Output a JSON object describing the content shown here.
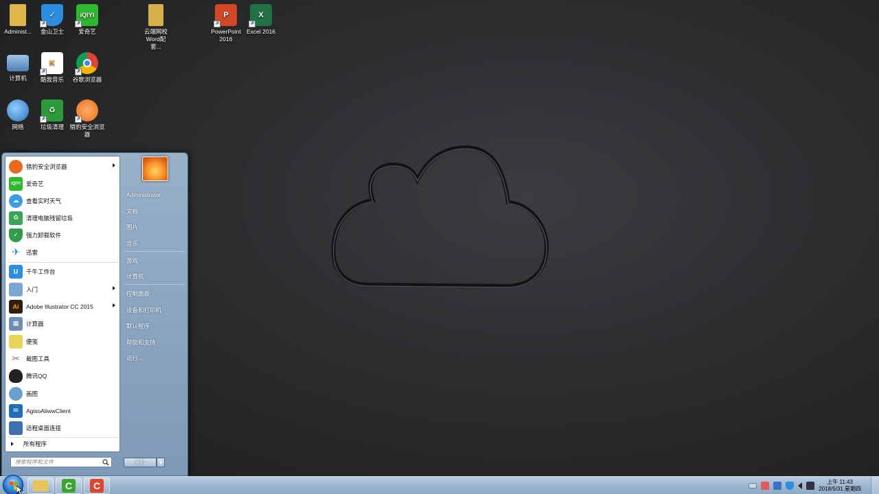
{
  "desktop": {
    "icons": [
      {
        "label": "Administ...",
        "icon": "folder-user-icon",
        "color": "#e9c25a"
      },
      {
        "label": "金山卫士",
        "icon": "shield-icon",
        "color": "#2d8ee0"
      },
      {
        "label": "爱奇艺",
        "icon": "iqiyi-icon",
        "color": "#2eb82e"
      },
      {
        "label": "云端网校 Word配套...",
        "icon": "folder-icon",
        "color": "#e9c25a"
      },
      {
        "label": "PowerPoint 2016",
        "icon": "powerpoint-icon",
        "color": "#d24726"
      },
      {
        "label": "Excel 2016",
        "icon": "excel-icon",
        "color": "#217346"
      },
      {
        "label": "计算机",
        "icon": "computer-icon",
        "color": "#5b8fc7"
      },
      {
        "label": "酷我音乐",
        "icon": "kuwo-music-icon",
        "color": "#f5a623"
      },
      {
        "label": "谷歌浏览器",
        "icon": "chrome-icon",
        "color": "#db4437"
      },
      {
        "label": "网络",
        "icon": "network-icon",
        "color": "#3a8ed8"
      },
      {
        "label": "垃圾清理",
        "icon": "trash-cleaner-icon",
        "color": "#2c9a3a"
      },
      {
        "label": "猎豹安全浏览器",
        "icon": "liebao-browser-icon",
        "color": "#e86a1a"
      }
    ]
  },
  "start_menu": {
    "programs": [
      {
        "label": "猎豹安全浏览器",
        "icon": "liebao-browser-icon",
        "color": "#e86a1a",
        "submenu": true
      },
      {
        "label": "爱奇艺",
        "icon": "iqiyi-icon",
        "color": "#2eb82e",
        "submenu": false
      },
      {
        "label": "查看实时天气",
        "icon": "weather-icon",
        "color": "#3b9ce8",
        "submenu": false
      },
      {
        "label": "清理电脑残留垃圾",
        "icon": "recycle-icon",
        "color": "#3aa655",
        "submenu": false
      },
      {
        "label": "强力卸载软件",
        "icon": "uninstall-shield-icon",
        "color": "#2f9d4a",
        "submenu": false
      },
      {
        "label": "迅雷",
        "icon": "xunlei-icon",
        "color": "#3b7fd4",
        "submenu": false
      },
      {
        "label": "千牛工作台",
        "icon": "qianniu-icon",
        "color": "#2d8ee0",
        "submenu": false
      },
      {
        "label": "入门",
        "icon": "getting-started-icon",
        "color": "#7aa7d6",
        "submenu": true
      },
      {
        "label": "Adobe Illustrator CC 2015",
        "icon": "illustrator-icon",
        "color": "#2e1e0e",
        "submenu": true
      },
      {
        "label": "计算器",
        "icon": "calculator-icon",
        "color": "#6d8fb3",
        "submenu": false
      },
      {
        "label": "便笺",
        "icon": "sticky-notes-icon",
        "color": "#e8d25a",
        "submenu": false
      },
      {
        "label": "截图工具",
        "icon": "snipping-tool-icon",
        "color": "#c94a4a",
        "submenu": false
      },
      {
        "label": "腾讯QQ",
        "icon": "qq-icon",
        "color": "#222222",
        "submenu": false
      },
      {
        "label": "画图",
        "icon": "paint-icon",
        "color": "#6aa0d0",
        "submenu": false
      },
      {
        "label": "AgisoAliwwClient",
        "icon": "agiso-icon",
        "color": "#1f6fb8",
        "submenu": false
      },
      {
        "label": "远程桌面连接",
        "icon": "remote-desktop-icon",
        "color": "#3f6fb0",
        "submenu": false
      }
    ],
    "all_programs": "所有程序",
    "search_placeholder": "搜索程序和文件",
    "right_items": [
      "Administrator",
      "文档",
      "图片",
      "音乐",
      "游戏",
      "计算机",
      "控制面板",
      "设备和打印机",
      "默认程序",
      "帮助和支持",
      "运行..."
    ],
    "shutdown_label": "关机"
  },
  "taskbar": {
    "pinned": [
      {
        "name": "explorer",
        "icon": "folder-icon",
        "color": "#e9c25a"
      },
      {
        "name": "camtasia-green",
        "icon": "camtasia-icon",
        "color": "#3aa62e"
      },
      {
        "name": "camtasia-red",
        "icon": "recorder-icon",
        "color": "#e0452b"
      }
    ],
    "clock_time": "上午 11:43",
    "clock_date": "2018/5/31 星期四"
  },
  "colors": {
    "accent": "#2f7bd1",
    "menu_right": "#8aa5c0"
  }
}
